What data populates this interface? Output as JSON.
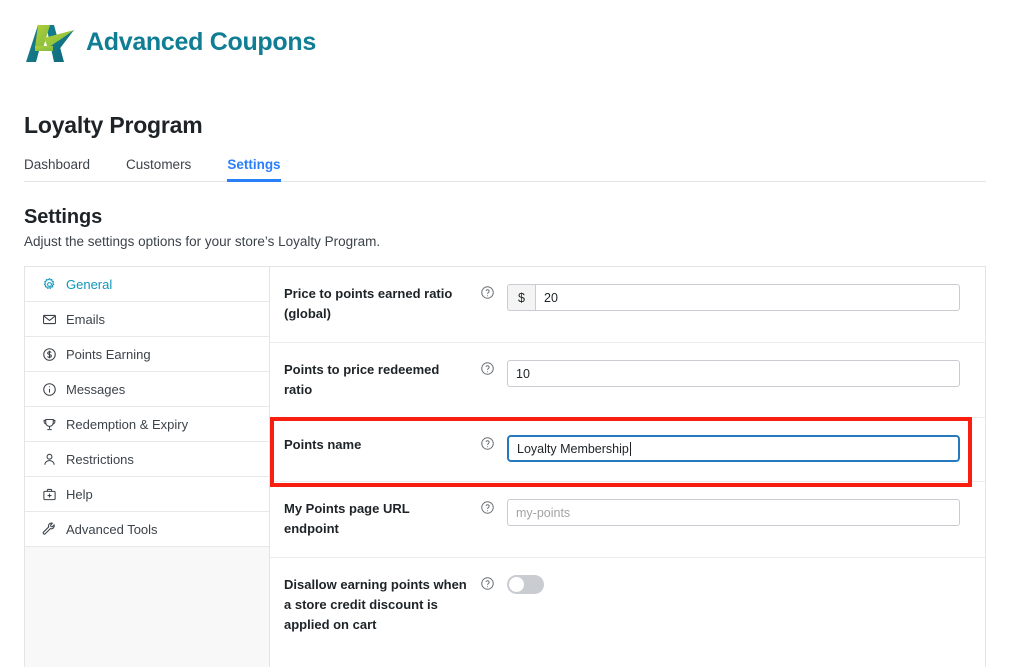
{
  "brand": {
    "name": "Advanced Coupons",
    "logo_icon": "advanced-coupons-logo",
    "color_primary": "#0f7d93",
    "color_accent_green": "#9ac22a"
  },
  "header": {
    "page_title": "Loyalty Program"
  },
  "tabs": [
    {
      "label": "Dashboard",
      "active": false
    },
    {
      "label": "Customers",
      "active": false
    },
    {
      "label": "Settings",
      "active": true
    }
  ],
  "section": {
    "title": "Settings",
    "description": "Adjust the settings options for your store’s Loyalty Program."
  },
  "sidebar": {
    "items": [
      {
        "label": "General",
        "icon": "gear-icon",
        "active": true
      },
      {
        "label": "Emails",
        "icon": "envelope-icon",
        "active": false
      },
      {
        "label": "Points Earning",
        "icon": "dollar-circle-icon",
        "active": false
      },
      {
        "label": "Messages",
        "icon": "info-circle-icon",
        "active": false
      },
      {
        "label": "Redemption & Expiry",
        "icon": "trophy-icon",
        "active": false
      },
      {
        "label": "Restrictions",
        "icon": "person-icon",
        "active": false
      },
      {
        "label": "Help",
        "icon": "first-aid-kit-icon",
        "active": false
      },
      {
        "label": "Advanced Tools",
        "icon": "wrench-icon",
        "active": false
      }
    ]
  },
  "form": {
    "help_icon": "question-circle-icon",
    "rows": [
      {
        "label": "Price to points earned ratio (global)",
        "prefix": "$",
        "value": "20",
        "placeholder": "",
        "type": "text-with-prefix"
      },
      {
        "label": "Points to price redeemed ratio",
        "value": "10",
        "placeholder": "",
        "type": "text"
      },
      {
        "label": "Points name",
        "value": "Loyalty Membership",
        "placeholder": "",
        "type": "text",
        "focused": true,
        "highlighted": true
      },
      {
        "label": "My Points page URL endpoint",
        "value": "",
        "placeholder": "my-points",
        "type": "text"
      },
      {
        "label": "Disallow earning points when a store credit discount is applied on cart",
        "type": "toggle",
        "toggle_on": false
      }
    ]
  },
  "annotation": {
    "highlight_color": "#f81f11",
    "target": "points-name-row"
  }
}
